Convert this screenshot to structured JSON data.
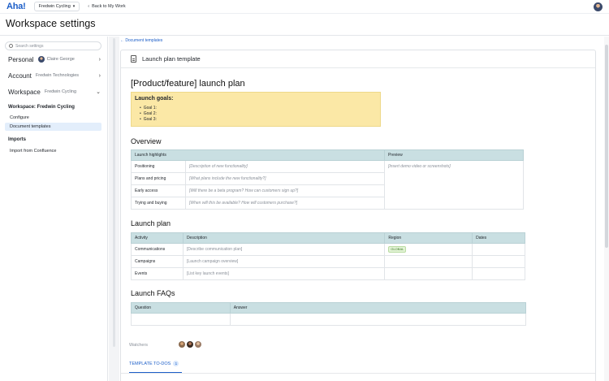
{
  "topbar": {
    "logo": "Aha!",
    "account": "Fredwin Cycling",
    "back_link": "Back to My Work",
    "avatar_icon": "user-avatar"
  },
  "page": {
    "title": "Workspace settings"
  },
  "sidebar": {
    "search_placeholder": "Search settings",
    "rows": [
      {
        "main": "Personal",
        "sub": "Claire George",
        "chevron": "›"
      },
      {
        "main": "Account",
        "sub": "Fredwin Technologies",
        "chevron": "›"
      },
      {
        "main": "Workspace",
        "sub": "Fredwin Cycling",
        "chevron": "⌄"
      }
    ],
    "workspace_heading": "Workspace: Fredwin Cycling",
    "workspace_links": [
      "Configure",
      "Document templates"
    ],
    "active_link": "Document templates",
    "imports_heading": "Imports",
    "imports_links": [
      "Import from Confluence"
    ]
  },
  "main": {
    "back_link": "← Document templates",
    "card_title": "Launch plan template",
    "doc_title": "[Product/feature] launch plan",
    "goals": {
      "title": "Launch goals:",
      "items": [
        "Goal 1:",
        "Goal 2:",
        "Goal 3:"
      ]
    },
    "overview": {
      "heading": "Overview",
      "headers": [
        "Launch highlights",
        "Preview"
      ],
      "rows": [
        [
          "Positioning",
          "[Description of new functionality]"
        ],
        [
          "Plans and pricing",
          "[What plans include the new functionality?]"
        ],
        [
          "Early access",
          "[Will there be a beta program? How can customers sign up?]"
        ],
        [
          "Trying and buying",
          "[When will this be available? How will customers purchase?]"
        ]
      ],
      "preview": "[Insert demo video or screenshots]"
    },
    "launch_plan": {
      "heading": "Launch plan",
      "headers": [
        "Activity",
        "Description",
        "Region",
        "Dates"
      ],
      "rows": [
        [
          "Communications",
          "[Describe communication plan]",
          "GLOBAL",
          ""
        ],
        [
          "Campaigns",
          "[Launch campaign overview]",
          "",
          ""
        ],
        [
          "Events",
          "[List key launch events]",
          "",
          ""
        ]
      ]
    },
    "faqs": {
      "heading": "Launch FAQs",
      "headers": [
        "Question",
        "Answer"
      ]
    },
    "watchers_label": "Watchers",
    "tab_label": "TEMPLATE TO-DOS",
    "tab_count": "1"
  },
  "colors": {
    "accent": "#1c5ec8",
    "table_header": "#c9dfe2",
    "goals_bg": "#fbe8a6",
    "active_nav": "#e3eefb"
  }
}
